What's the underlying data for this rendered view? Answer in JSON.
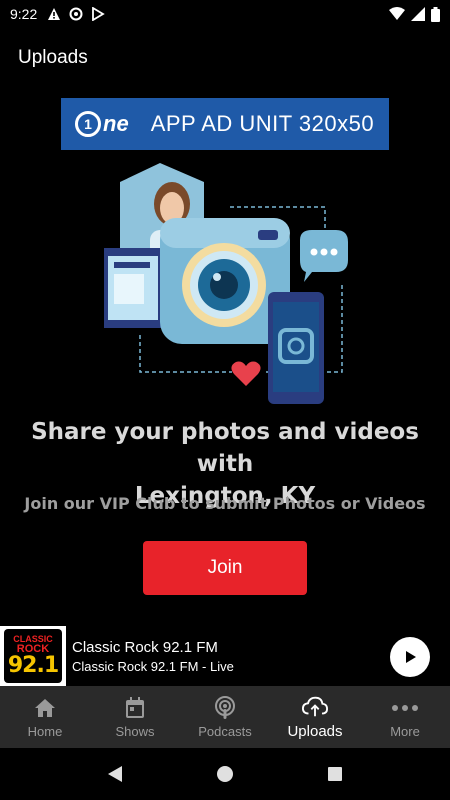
{
  "status_bar": {
    "time": "9:22"
  },
  "header": {
    "title": "Uploads"
  },
  "ad": {
    "logo_char": "1",
    "logo_text": "ne",
    "text": "APP AD UNIT 320x50"
  },
  "content": {
    "headline_line1": "Share your photos and videos with",
    "headline_line2": "Lexington, KY",
    "subline": "Join our VIP Club to submit Photos or Videos",
    "join_label": "Join"
  },
  "player": {
    "art_classic": "CLASSIC",
    "art_rock": "ROCK",
    "art_freq": "92.1",
    "title": "Classic Rock 92.1 FM",
    "subtitle": "Classic Rock 92.1 FM - Live"
  },
  "nav": {
    "items": [
      {
        "label": "Home",
        "icon": "home-icon"
      },
      {
        "label": "Shows",
        "icon": "calendar-icon"
      },
      {
        "label": "Podcasts",
        "icon": "podcast-icon"
      },
      {
        "label": "Uploads",
        "icon": "cloud-upload-icon",
        "active": true
      },
      {
        "label": "More",
        "icon": "more-icon"
      }
    ]
  },
  "colors": {
    "accent": "#e8232a",
    "ad_blue": "#1f5aa8",
    "nav_bg": "#2a2a2a"
  }
}
